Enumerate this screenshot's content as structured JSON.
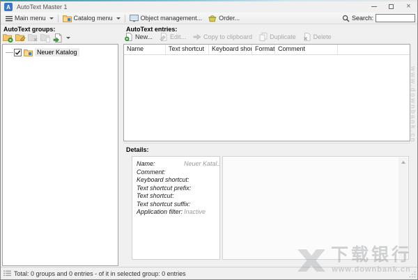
{
  "window": {
    "title": "AutoText Master 1"
  },
  "toolbar": {
    "main_menu_label": "Main menu",
    "catalog_menu_label": "Catalog menu",
    "object_management_label": "Object management...",
    "order_label": "Order...",
    "search_label": "Search:",
    "search_value": ""
  },
  "groups_panel": {
    "title": "AutoText groups:",
    "tree_items": [
      {
        "label": "Neuer Katalog",
        "checked": true
      }
    ]
  },
  "entries_panel": {
    "title": "AutoText entries:",
    "buttons": [
      {
        "label": "New...",
        "enabled": true
      },
      {
        "label": "Edit...",
        "enabled": false
      },
      {
        "label": "Copy to clipboard",
        "enabled": false
      },
      {
        "label": "Duplicate",
        "enabled": false
      },
      {
        "label": "Delete",
        "enabled": false
      }
    ],
    "columns": [
      "Name",
      "Text shortcut",
      "Keyboard short...",
      "Format",
      "Comment"
    ],
    "rows": []
  },
  "details_panel": {
    "title": "Details:",
    "fields": [
      {
        "label": "Name:",
        "value": "Neuer Katal..."
      },
      {
        "label": "Comment:",
        "value": ""
      },
      {
        "label": "Keyboard shortcut:",
        "value": ""
      },
      {
        "label": "Text shortcut prefix:",
        "value": ""
      },
      {
        "label": "Text shortcut:",
        "value": ""
      },
      {
        "label": "Text shortcut suffix:",
        "value": ""
      },
      {
        "label": "Application filter:",
        "value": "Inactive"
      }
    ]
  },
  "status_bar": {
    "text": "Total: 0 groups and 0 entries - of it in selected group: 0 entries"
  },
  "watermark": {
    "title": "下载银行",
    "url": "www.downbank.cn",
    "side_text": "www.downbank.cn"
  },
  "icons": {
    "app": "A",
    "minimize": "minimize-line",
    "maximize": "maximize-box",
    "close": "×",
    "main_menu": "hamburger",
    "catalog_menu": "folder",
    "object_management": "window-monitor",
    "order": "shopping-basket",
    "search": "magnifier",
    "add_group": "folder-plus",
    "edit_group": "folder-pencil",
    "delete_group": "folder-x",
    "copy_group": "folder-page",
    "import_export": "page-arrow",
    "new_entry": "page-plus",
    "edit_entry": "page-pencil",
    "copy_entry": "arrow-right",
    "duplicate_entry": "two-pages",
    "delete_entry": "page-x",
    "status": "list-grid"
  },
  "colors": {
    "accent_border": "#2f8f9b",
    "window_bg": "#f0f0f0",
    "panel_bg": "#ffffff",
    "folder": "#f6c46a",
    "app_icon": "#3a76c4",
    "enabled_text": "#333333",
    "disabled_text": "#a8a8a8",
    "value_text": "#9b9b9b",
    "watermark": "#9ba0a5"
  }
}
